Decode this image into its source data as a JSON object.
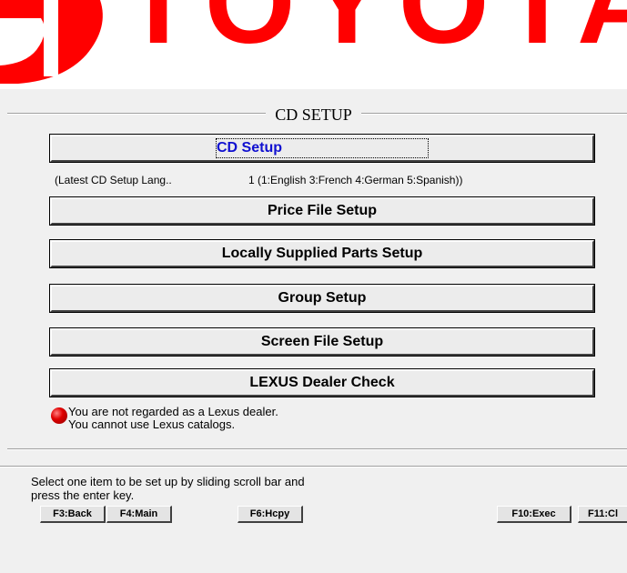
{
  "brand": {
    "logo_text": "TOYOTA"
  },
  "section": {
    "title": "CD SETUP"
  },
  "buttons": [
    {
      "label": "CD Setup"
    },
    {
      "label": "Price File Setup"
    },
    {
      "label": "Locally Supplied Parts Setup"
    },
    {
      "label": "Group Setup"
    },
    {
      "label": "Screen File Setup"
    },
    {
      "label": "LEXUS Dealer Check"
    }
  ],
  "language": {
    "label": "(Latest CD Setup Lang..",
    "value": "1  (1:English 3:French 4:German 5:Spanish))"
  },
  "lexus_message": {
    "line1": "You are not regarded as a Lexus dealer.",
    "line2": "You cannot use Lexus catalogs.",
    "icon": "red-ball-icon"
  },
  "status": {
    "line1": "Select one item to be set up by sliding scroll bar and",
    "line2": "press the enter key."
  },
  "fkeys": {
    "f3": "F3:Back",
    "f4": "F4:Main",
    "f6": "F6:Hcpy",
    "f10": "F10:Exec",
    "f11": "F11:Cl"
  },
  "colors": {
    "logo_red": "#ff0000",
    "active_label": "#1010d0",
    "background": "#f0f0f0"
  }
}
